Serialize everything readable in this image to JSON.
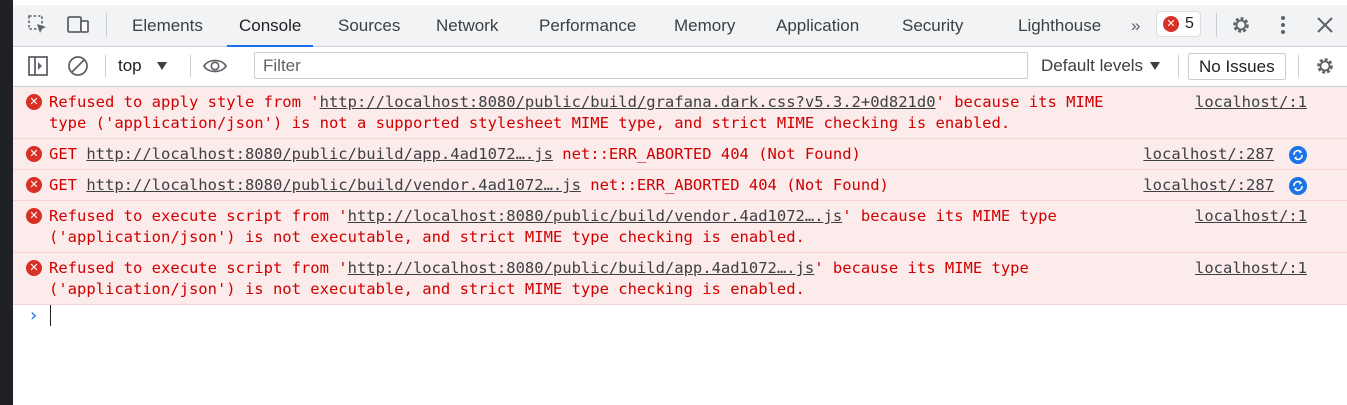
{
  "tabs": [
    "Elements",
    "Console",
    "Sources",
    "Network",
    "Performance",
    "Memory",
    "Application",
    "Security",
    "Lighthouse"
  ],
  "active_tab": "Console",
  "more_tabs_label": "»",
  "error_count": "5",
  "toolbar": {
    "context": "top",
    "filter_placeholder": "Filter",
    "levels": "Default levels",
    "issues": "No Issues"
  },
  "messages": [
    {
      "pre": "Refused to apply style from '",
      "link": "http://localhost:8080/public/build/grafana.dark.css?v5.3.2+0d821d0",
      "post": "' because its MIME type ('application/json') is not a supported stylesheet MIME type, and strict MIME checking is enabled.",
      "source": "localhost/:1"
    },
    {
      "pre": "GET ",
      "link": "http://localhost:8080/public/build/app.4ad1072….js",
      "post": " net::ERR_ABORTED 404 (Not Found)",
      "source": "localhost/:287"
    },
    {
      "pre": "GET ",
      "link": "http://localhost:8080/public/build/vendor.4ad1072….js",
      "post": " net::ERR_ABORTED 404 (Not Found)",
      "source": "localhost/:287"
    },
    {
      "pre": "Refused to execute script from '",
      "link": "http://localhost:8080/public/build/vendor.4ad1072….js",
      "post": "' because its MIME type ('application/json') is not executable, and strict MIME type checking is enabled.",
      "source": "localhost/:1"
    },
    {
      "pre": "Refused to execute script from '",
      "link": "http://localhost:8080/public/build/app.4ad1072….js",
      "post": "' because its MIME type ('application/json') is not executable, and strict MIME type checking is enabled.",
      "source": "localhost/:1"
    }
  ],
  "prompt": "›",
  "colors": {
    "error_text": "#d00000",
    "error_bg": "#fcebeb",
    "accent": "#1a73e8"
  }
}
